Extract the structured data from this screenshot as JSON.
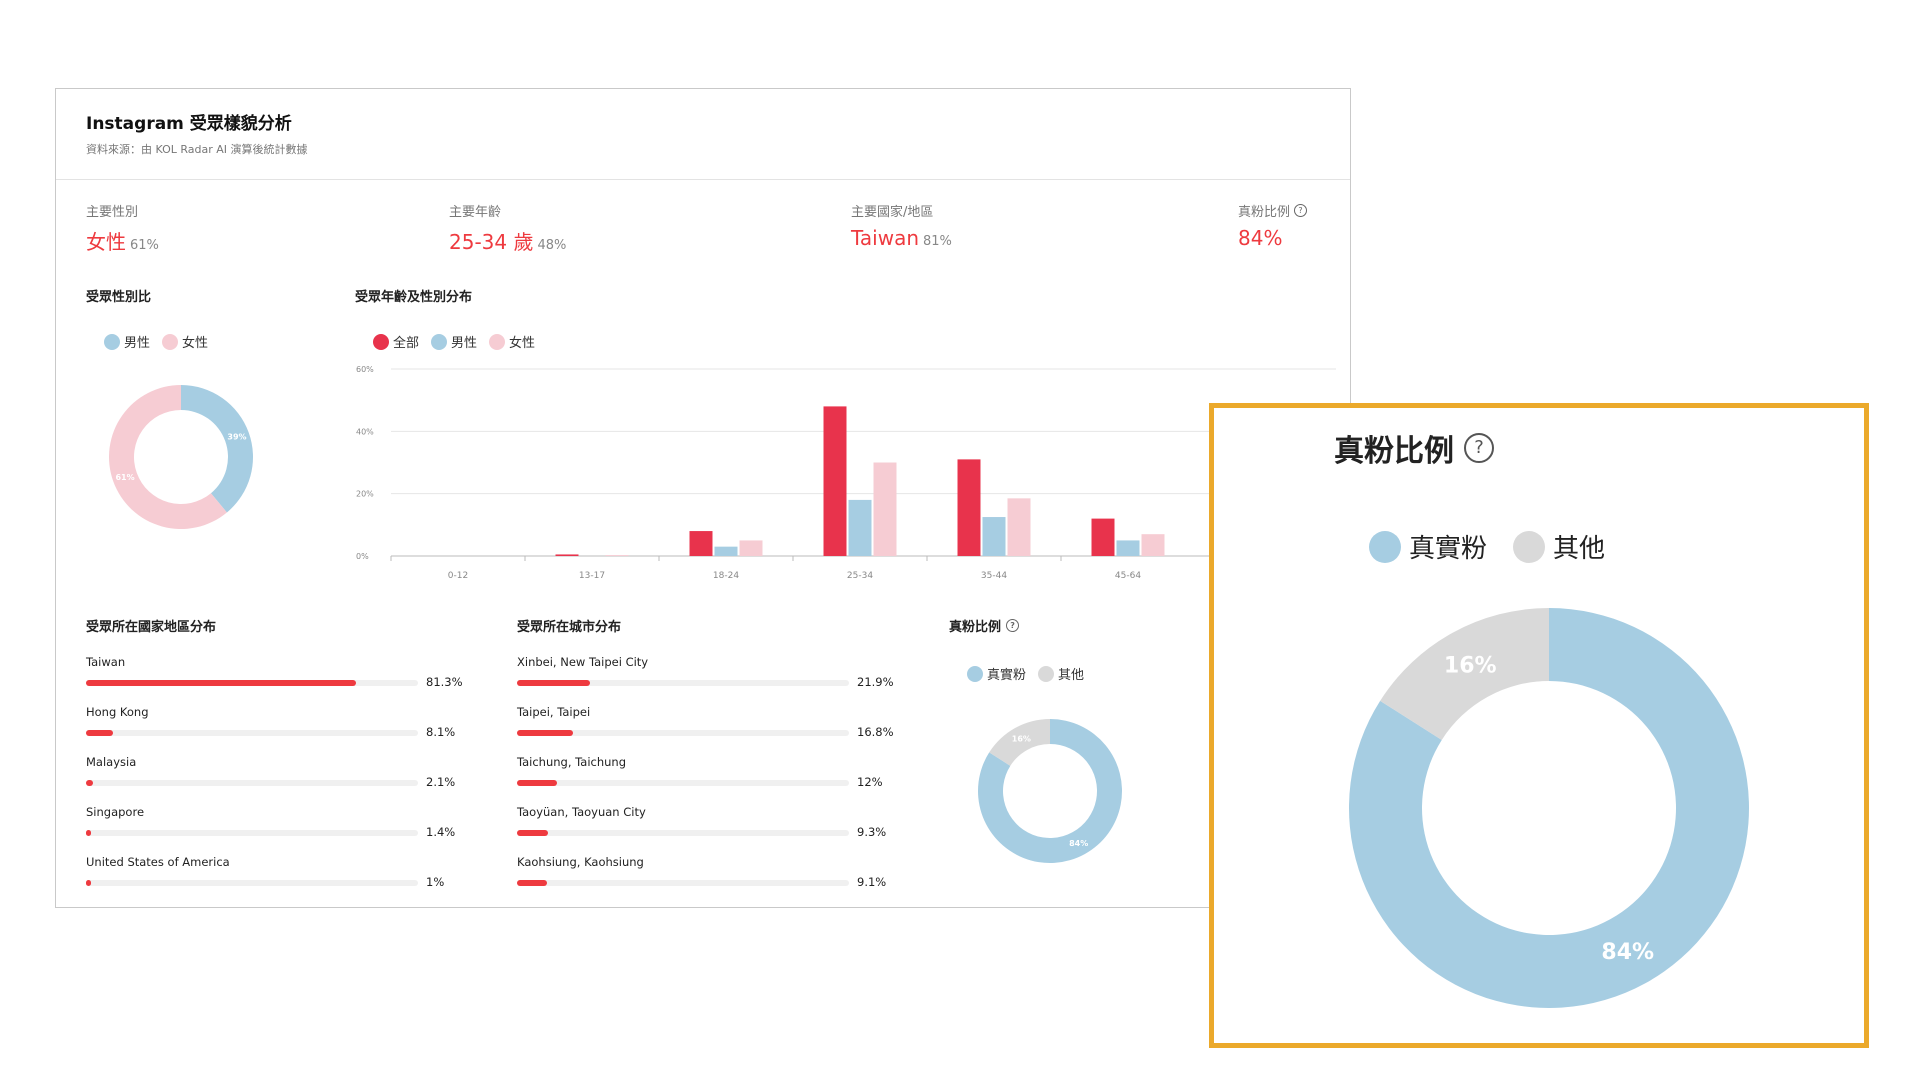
{
  "header": {
    "title": "Instagram 受眾樣貌分析",
    "subtitle": "資料來源：由 KOL Radar AI 演算後統計數據"
  },
  "kpis": {
    "gender": {
      "label": "主要性別",
      "value": "女性",
      "pct": "61%"
    },
    "age": {
      "label": "主要年齡",
      "value": "25-34 歲",
      "pct": "48%"
    },
    "country": {
      "label": "主要國家/地區",
      "value": "Taiwan",
      "pct": "81%"
    },
    "real": {
      "label": "真粉比例",
      "value": "84%"
    }
  },
  "colors": {
    "accent": "#ee3a3f",
    "male": "#a6cde2",
    "female": "#f6ccd3",
    "all": "#e8334c",
    "other": "#d9d9d9"
  },
  "gender_section": {
    "title": "受眾性別比",
    "legend": [
      "男性",
      "女性"
    ],
    "chart_data": {
      "type": "pie",
      "labels": [
        "男性",
        "女性"
      ],
      "values": [
        39,
        61
      ],
      "value_labels": [
        "39%",
        "61%"
      ],
      "donut": true
    }
  },
  "age_section": {
    "title": "受眾年齡及性別分布",
    "legend": [
      "全部",
      "男性",
      "女性"
    ],
    "y_ticks": [
      "0%",
      "20%",
      "40%",
      "60%"
    ],
    "chart_data": {
      "type": "bar",
      "categories": [
        "0-12",
        "13-17",
        "18-24",
        "25-34",
        "35-44",
        "45-64"
      ],
      "series": [
        {
          "name": "全部",
          "values": [
            0,
            0.5,
            8,
            48,
            31,
            12
          ]
        },
        {
          "name": "男性",
          "values": [
            0,
            0,
            3,
            18,
            12.5,
            5
          ]
        },
        {
          "name": "女性",
          "values": [
            0,
            0.3,
            5,
            30,
            18.5,
            7
          ]
        }
      ],
      "ylim": [
        0,
        60
      ],
      "grid": true
    }
  },
  "country_section": {
    "title": "受眾所在國家地區分布",
    "items": [
      {
        "name": "Taiwan",
        "value_label": "81.3%",
        "value": 81.3
      },
      {
        "name": "Hong Kong",
        "value_label": "8.1%",
        "value": 8.1
      },
      {
        "name": "Malaysia",
        "value_label": "2.1%",
        "value": 2.1
      },
      {
        "name": "Singapore",
        "value_label": "1.4%",
        "value": 1.4
      },
      {
        "name": "United States of America",
        "value_label": "1%",
        "value": 1
      }
    ]
  },
  "city_section": {
    "title": "受眾所在城市分布",
    "items": [
      {
        "name": "Xinbei, New Taipei City",
        "value_label": "21.9%",
        "value": 21.9
      },
      {
        "name": "Taipei, Taipei",
        "value_label": "16.8%",
        "value": 16.8
      },
      {
        "name": "Taichung, Taichung",
        "value_label": "12%",
        "value": 12
      },
      {
        "name": "Taoyüan, Taoyuan City",
        "value_label": "9.3%",
        "value": 9.3
      },
      {
        "name": "Kaohsiung, Kaohsiung",
        "value_label": "9.1%",
        "value": 9.1
      }
    ]
  },
  "real_section": {
    "title": "真粉比例",
    "legend": [
      "真實粉",
      "其他"
    ],
    "chart_data": {
      "type": "pie",
      "labels": [
        "真實粉",
        "其他"
      ],
      "values": [
        84,
        16
      ],
      "value_labels": [
        "84%",
        "16%"
      ],
      "donut": true
    }
  },
  "popup": {
    "title": "真粉比例",
    "legend": [
      "真實粉",
      "其他"
    ],
    "chart_data": {
      "type": "pie",
      "labels": [
        "真實粉",
        "其他"
      ],
      "values": [
        84,
        16
      ],
      "value_labels": [
        "84%",
        "16%"
      ],
      "donut": true
    }
  }
}
